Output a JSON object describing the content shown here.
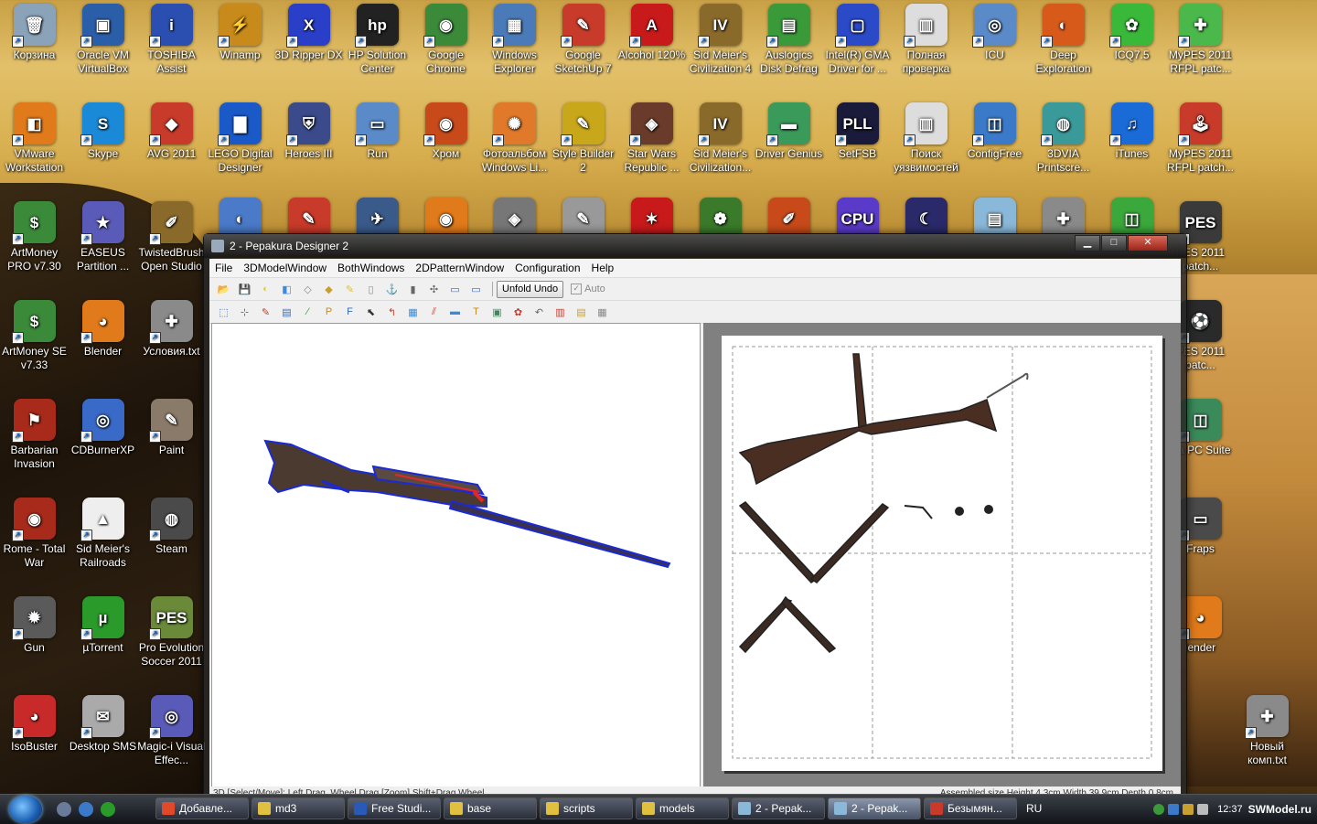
{
  "desktop_icons": [
    {
      "label": "Корзина",
      "glyph": "🗑",
      "color": "#8aa3b8",
      "col": 0,
      "row": 0
    },
    {
      "label": "Oracle VM VirtualBox",
      "glyph": "▣",
      "color": "#2b5ea8",
      "col": 1,
      "row": 0
    },
    {
      "label": "TOSHIBA Assist",
      "glyph": "i",
      "color": "#2a4fb0",
      "col": 2,
      "row": 0
    },
    {
      "label": "Winamp",
      "glyph": "⚡",
      "color": "#c88a1a",
      "col": 3,
      "row": 0
    },
    {
      "label": "3D Ripper DX",
      "glyph": "X",
      "color": "#2a3fc8",
      "col": 4,
      "row": 0
    },
    {
      "label": "HP Solution Center",
      "glyph": "hp",
      "color": "#222",
      "col": 5,
      "row": 0
    },
    {
      "label": "Google Chrome",
      "glyph": "◉",
      "color": "#3a8a3a",
      "col": 6,
      "row": 0
    },
    {
      "label": "Windows Explorer",
      "glyph": "▦",
      "color": "#4a7ab8",
      "col": 7,
      "row": 0
    },
    {
      "label": "Google SketchUp 7",
      "glyph": "✎",
      "color": "#c83a2a",
      "col": 8,
      "row": 0
    },
    {
      "label": "Alcohol 120%",
      "glyph": "A",
      "color": "#c81a1a",
      "col": 9,
      "row": 0
    },
    {
      "label": "Sid Meier's Civilization 4",
      "glyph": "IV",
      "color": "#8a6a2a",
      "col": 10,
      "row": 0
    },
    {
      "label": "Auslogics Disk Defrag",
      "glyph": "▤",
      "color": "#3a9a3a",
      "col": 11,
      "row": 0
    },
    {
      "label": "Intel(R) GMA Driver for ...",
      "glyph": "▢",
      "color": "#2a4ac8",
      "col": 12,
      "row": 0
    },
    {
      "label": "Полная проверка",
      "glyph": "▥",
      "color": "#ddd",
      "col": 13,
      "row": 0
    },
    {
      "label": "ICU",
      "glyph": "◎",
      "color": "#5a8ac8",
      "col": 14,
      "row": 0
    },
    {
      "label": "Deep Exploration",
      "glyph": "◐",
      "color": "#d85a1a",
      "col": 15,
      "row": 0
    },
    {
      "label": "ICQ7.5",
      "glyph": "✿",
      "color": "#3ab83a",
      "col": 16,
      "row": 0
    },
    {
      "label": "MyPES 2011 RFPL patc...",
      "glyph": "✚",
      "color": "#4ab84a",
      "col": 17,
      "row": 0
    },
    {
      "label": "VMware Workstation",
      "glyph": "◧",
      "color": "#e07a1a",
      "col": 0,
      "row": 1
    },
    {
      "label": "Skype",
      "glyph": "S",
      "color": "#1a8ad8",
      "col": 1,
      "row": 1
    },
    {
      "label": "AVG 2011",
      "glyph": "◆",
      "color": "#c83a2a",
      "col": 2,
      "row": 1
    },
    {
      "label": "LEGO Digital Designer",
      "glyph": "▇",
      "color": "#1a5ac8",
      "col": 3,
      "row": 1
    },
    {
      "label": "Heroes III",
      "glyph": "⛨",
      "color": "#3a4a8a",
      "col": 4,
      "row": 1
    },
    {
      "label": "Run",
      "glyph": "▭",
      "color": "#5a8ac8",
      "col": 5,
      "row": 1
    },
    {
      "label": "Хром",
      "glyph": "◉",
      "color": "#c84a1a",
      "col": 6,
      "row": 1
    },
    {
      "label": "Фотоальбом Windows Li...",
      "glyph": "✺",
      "color": "#e07a2a",
      "col": 7,
      "row": 1
    },
    {
      "label": "Style Builder 2",
      "glyph": "✎",
      "color": "#c8a81a",
      "col": 8,
      "row": 1
    },
    {
      "label": "Star Wars Republic ...",
      "glyph": "◈",
      "color": "#6a3a2a",
      "col": 9,
      "row": 1
    },
    {
      "label": "Sid Meier's Civilization...",
      "glyph": "IV",
      "color": "#8a6a2a",
      "col": 10,
      "row": 1
    },
    {
      "label": "Driver Genius",
      "glyph": "▬",
      "color": "#3a9a5a",
      "col": 11,
      "row": 1
    },
    {
      "label": "SetFSB",
      "glyph": "PLL",
      "color": "#1a1a3a",
      "col": 12,
      "row": 1
    },
    {
      "label": "Поиск уязвимостей",
      "glyph": "▥",
      "color": "#ddd",
      "col": 13,
      "row": 1
    },
    {
      "label": "ConfigFree",
      "glyph": "◫",
      "color": "#3a7ac8",
      "col": 14,
      "row": 1
    },
    {
      "label": "3DVIA Printscre...",
      "glyph": "◍",
      "color": "#3a9a9a",
      "col": 15,
      "row": 1
    },
    {
      "label": "iTunes",
      "glyph": "♫",
      "color": "#1a6ad8",
      "col": 16,
      "row": 1
    },
    {
      "label": "MyPES 2011 RFPL patch...",
      "glyph": "🕹",
      "color": "#c83a2a",
      "col": 17,
      "row": 1
    },
    {
      "label": "ArtMoney PRO v7.30",
      "glyph": "$",
      "color": "#3a8a3a",
      "col": 0,
      "row": 2
    },
    {
      "label": "EASEUS Partition ...",
      "glyph": "★",
      "color": "#5a5ab8",
      "col": 1,
      "row": 2
    },
    {
      "label": "TwistedBrush Open Studio",
      "glyph": "✐",
      "color": "#8a6a2a",
      "col": 2,
      "row": 2
    },
    {
      "label": "ArtMoney SE v7.33",
      "glyph": "$",
      "color": "#3a8a3a",
      "col": 0,
      "row": 3
    },
    {
      "label": "Blender",
      "glyph": "◕",
      "color": "#e07a1a",
      "col": 1,
      "row": 3
    },
    {
      "label": "Условия.txt",
      "glyph": "✚",
      "color": "#8a8a8a",
      "col": 2,
      "row": 3
    },
    {
      "label": "Barbarian Invasion",
      "glyph": "⚑",
      "color": "#a82a1a",
      "col": 0,
      "row": 4
    },
    {
      "label": "CDBurnerXP",
      "glyph": "◎",
      "color": "#3a6ac8",
      "col": 1,
      "row": 4
    },
    {
      "label": "Paint",
      "glyph": "✎",
      "color": "#8a7a6a",
      "col": 2,
      "row": 4
    },
    {
      "label": "Rome - Total War",
      "glyph": "◉",
      "color": "#a82a1a",
      "col": 0,
      "row": 5
    },
    {
      "label": "Sid Meier's Railroads",
      "glyph": "▲",
      "color": "#eee",
      "col": 1,
      "row": 5
    },
    {
      "label": "Steam",
      "glyph": "◍",
      "color": "#4a4a4a",
      "col": 2,
      "row": 5
    },
    {
      "label": "Gun",
      "glyph": "✹",
      "color": "#5a5a5a",
      "col": 0,
      "row": 6
    },
    {
      "label": "µTorrent",
      "glyph": "µ",
      "color": "#2a9a2a",
      "col": 1,
      "row": 6
    },
    {
      "label": "Pro Evolution Soccer 2011",
      "glyph": "PES",
      "color": "#6a8a3a",
      "col": 2,
      "row": 6
    },
    {
      "label": "IsoBuster",
      "glyph": "◕",
      "color": "#c82a2a",
      "col": 0,
      "row": 7
    },
    {
      "label": "Desktop SMS",
      "glyph": "✉",
      "color": "#aaa",
      "col": 1,
      "row": 7
    },
    {
      "label": "Magic-i Visual Effec...",
      "glyph": "◎",
      "color": "#5a5ab8",
      "col": 2,
      "row": 7
    },
    {
      "label": "PES 2011 patch...",
      "glyph": "PES",
      "color": "#3a3a3a",
      "col": 17,
      "row": 2
    },
    {
      "label": "PES 2011 patc...",
      "glyph": "⚽",
      "color": "#2a2a2a",
      "col": 17,
      "row": 3
    },
    {
      "label": "kia PC Suite",
      "glyph": "◫",
      "color": "#3a8a5a",
      "col": 17,
      "row": 4
    },
    {
      "label": "Fraps",
      "glyph": "▭",
      "color": "#4a4a4a",
      "col": 17,
      "row": 5
    },
    {
      "label": "lender",
      "glyph": "◕",
      "color": "#e07a1a",
      "col": 17,
      "row": 6
    },
    {
      "label": "Новый комп.txt",
      "glyph": "✚",
      "color": "#8a8a8a",
      "col": 18,
      "row": 7
    }
  ],
  "row3_extra_icons": [
    {
      "glyph": "◐",
      "color": "#4a7ac8"
    },
    {
      "glyph": "✎",
      "color": "#c83a2a"
    },
    {
      "glyph": "✈",
      "color": "#3a5a8a"
    },
    {
      "glyph": "◉",
      "color": "#e07a1a"
    },
    {
      "glyph": "◈",
      "color": "#777"
    },
    {
      "glyph": "✎",
      "color": "#999"
    },
    {
      "glyph": "✶",
      "color": "#c81a1a"
    },
    {
      "glyph": "❁",
      "color": "#3a7a2a"
    },
    {
      "glyph": "✐",
      "color": "#c84a1a"
    },
    {
      "glyph": "CPU",
      "color": "#5a3ac8"
    },
    {
      "glyph": "☾",
      "color": "#2a2a6a"
    },
    {
      "glyph": "▤",
      "color": "#8ab8d8"
    },
    {
      "glyph": "✚",
      "color": "#8a8a8a"
    },
    {
      "glyph": "◫",
      "color": "#3aa83a"
    }
  ],
  "window": {
    "title": "2 - Pepakura Designer 2",
    "menu": [
      "File",
      "3DModelWindow",
      "BothWindows",
      "2DPatternWindow",
      "Configuration",
      "Help"
    ],
    "unfold_undo": "Unfold Undo",
    "auto_label": "Auto",
    "status_left": "3D [Select/Move]: Left Drag, Wheel Drag [Zoom] Shift+Drag Wheel",
    "status_right": "Assembled size Height 4.3cm Width 39.9cm Depth 0.8cm"
  },
  "toolbar1": [
    {
      "g": "📂",
      "c": "#e0b040"
    },
    {
      "g": "💾",
      "c": "#4a6aa8"
    },
    {
      "g": "◐",
      "c": "#e0d040"
    },
    {
      "g": "◧",
      "c": "#3a8ae0"
    },
    {
      "g": "◇",
      "c": "#888"
    },
    {
      "g": "◆",
      "c": "#c8a030"
    },
    {
      "g": "✎",
      "c": "#e0c030"
    },
    {
      "g": "▯",
      "c": "#888"
    },
    {
      "g": "⚓",
      "c": "#666"
    },
    {
      "g": "▮",
      "c": "#666"
    },
    {
      "g": "✣",
      "c": "#666"
    },
    {
      "g": "▭",
      "c": "#3a6ab8"
    },
    {
      "g": "▭",
      "c": "#3a6ab8"
    }
  ],
  "toolbar2": [
    {
      "g": "⬚",
      "c": "#3a6ab8"
    },
    {
      "g": "⊹",
      "c": "#3a6ab8"
    },
    {
      "g": "✎",
      "c": "#c83a2a"
    },
    {
      "g": "▤",
      "c": "#3a6ab8"
    },
    {
      "g": "⁄",
      "c": "#3a9a3a"
    },
    {
      "g": "P",
      "c": "#c88a1a"
    },
    {
      "g": "F",
      "c": "#3a6ab8"
    },
    {
      "g": "⬉",
      "c": "#333"
    },
    {
      "g": "↰",
      "c": "#c83a2a"
    },
    {
      "g": "▦",
      "c": "#3a8ad8"
    },
    {
      "g": "⫽",
      "c": "#c83a2a"
    },
    {
      "g": "▬",
      "c": "#3a8ad8"
    },
    {
      "g": "T",
      "c": "#c88a1a"
    },
    {
      "g": "▣",
      "c": "#3a8a5a"
    },
    {
      "g": "✿",
      "c": "#c83a2a"
    },
    {
      "g": "↶",
      "c": "#666"
    },
    {
      "g": "▥",
      "c": "#c83a2a"
    },
    {
      "g": "▤",
      "c": "#c8a030"
    },
    {
      "g": "▦",
      "c": "#888"
    }
  ],
  "taskbar": {
    "tasks": [
      {
        "label": "Добавле...",
        "color": "#e04a2a",
        "active": false
      },
      {
        "label": "md3",
        "color": "#e0c040",
        "active": false
      },
      {
        "label": "Free Studi...",
        "color": "#2a5ab8",
        "active": false
      },
      {
        "label": "base",
        "color": "#e0c040",
        "active": false
      },
      {
        "label": "scripts",
        "color": "#e0c040",
        "active": false
      },
      {
        "label": "models",
        "color": "#e0c040",
        "active": false
      },
      {
        "label": "2 - Pepak...",
        "color": "#8ab8d8",
        "active": false
      },
      {
        "label": "2 - Pepak...",
        "color": "#8ab8d8",
        "active": true
      },
      {
        "label": "Безымян...",
        "color": "#c83a2a",
        "active": false
      }
    ],
    "lang": "RU",
    "clock": "12:37",
    "watermark": "SWModel.ru"
  }
}
